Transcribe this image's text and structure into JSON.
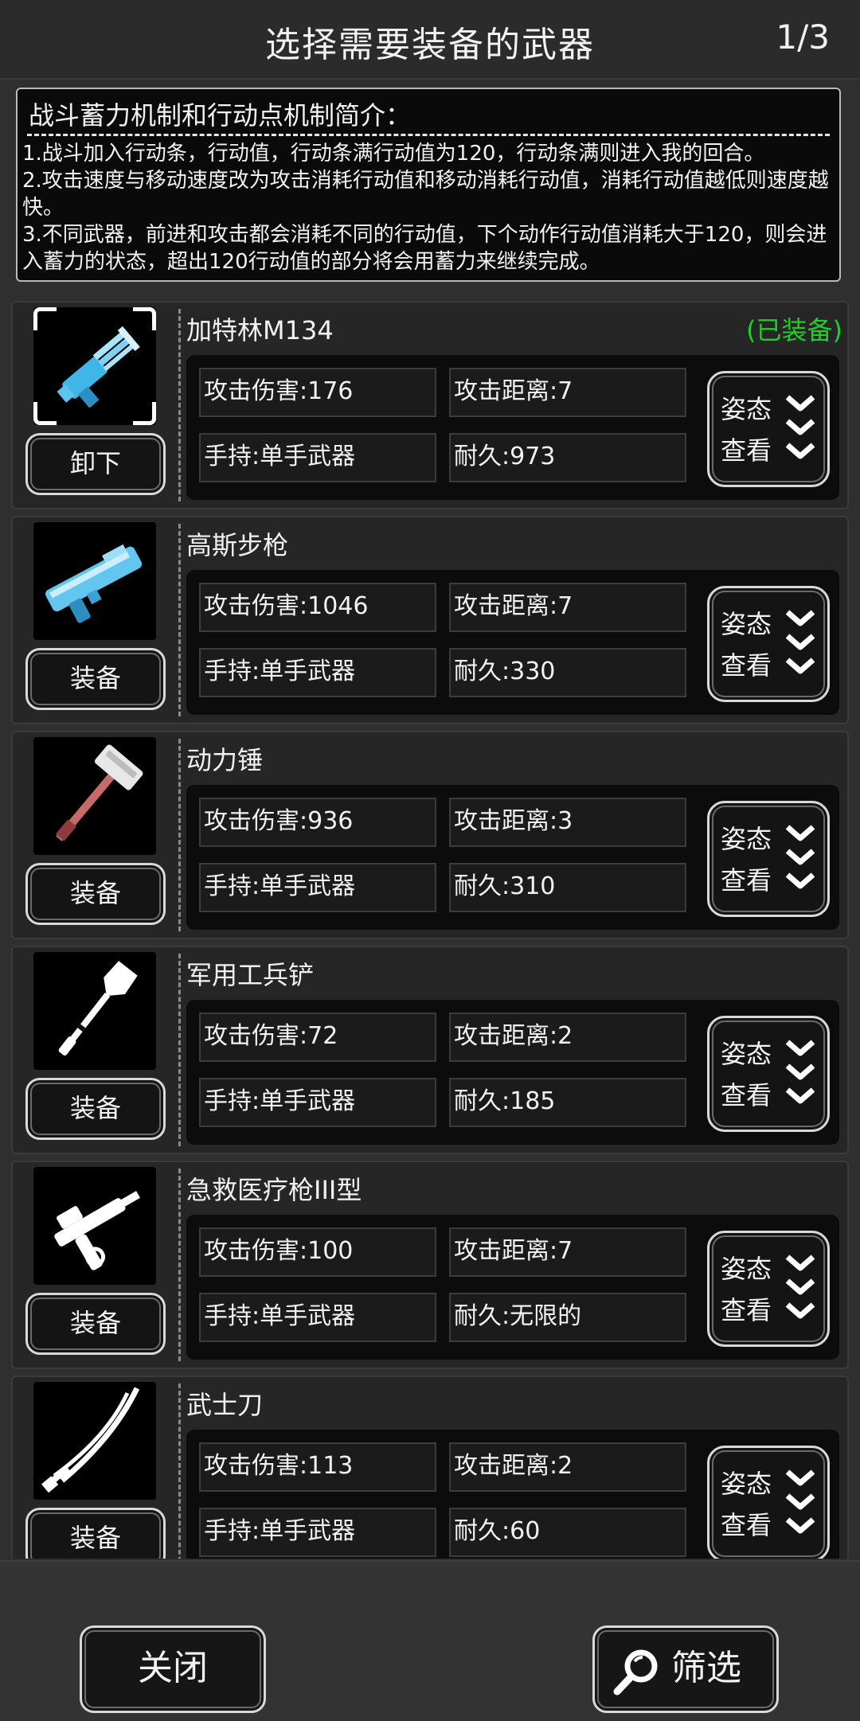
{
  "header": {
    "title": "选择需要装备的武器",
    "page": "1/3"
  },
  "intro": {
    "title": "战斗蓄力机制和行动点机制简介：",
    "lines": [
      "1.战斗加入行动条，行动值，行动条满行动值为120，行动条满则进入我的回合。",
      "2.攻击速度与移动速度改为攻击消耗行动值和移动消耗行动值，消耗行动值越低则速度越快。",
      "3.不同武器，前进和攻击都会消耗不同的行动值，下个动作行动值消耗大于120，则会进入蓄力的状态，超出120行动值的部分将会用蓄力来继续完成。"
    ]
  },
  "weapons": [
    {
      "name": "加特林M134",
      "status": "(已装备)",
      "action": "卸下",
      "attack": "攻击伤害:176",
      "range": "攻击距离:7",
      "hold": "手持:单手武器",
      "durability": "耐久:973",
      "pose1": "姿态",
      "pose2": "查看",
      "icon": "gatling-gun-icon"
    },
    {
      "name": "高斯步枪",
      "status": "",
      "action": "装备",
      "attack": "攻击伤害:1046",
      "range": "攻击距离:7",
      "hold": "手持:单手武器",
      "durability": "耐久:330",
      "pose1": "姿态",
      "pose2": "查看",
      "icon": "gauss-rifle-icon"
    },
    {
      "name": "动力锤",
      "status": "",
      "action": "装备",
      "attack": "攻击伤害:936",
      "range": "攻击距离:3",
      "hold": "手持:单手武器",
      "durability": "耐久:310",
      "pose1": "姿态",
      "pose2": "查看",
      "icon": "power-hammer-icon"
    },
    {
      "name": "军用工兵铲",
      "status": "",
      "action": "装备",
      "attack": "攻击伤害:72",
      "range": "攻击距离:2",
      "hold": "手持:单手武器",
      "durability": "耐久:185",
      "pose1": "姿态",
      "pose2": "查看",
      "icon": "shovel-icon"
    },
    {
      "name": "急救医疗枪III型",
      "status": "",
      "action": "装备",
      "attack": "攻击伤害:100",
      "range": "攻击距离:7",
      "hold": "手持:单手武器",
      "durability": "耐久:无限的",
      "pose1": "姿态",
      "pose2": "查看",
      "icon": "medical-gun-icon"
    },
    {
      "name": "武士刀",
      "status": "",
      "action": "装备",
      "attack": "攻击伤害:113",
      "range": "攻击距离:2",
      "hold": "手持:单手武器",
      "durability": "耐久:60",
      "pose1": "姿态",
      "pose2": "查看",
      "icon": "katana-icon"
    }
  ],
  "footer": {
    "close_label": "关闭",
    "filter_label": "筛选"
  },
  "colors": {
    "equipped": "#22cc2a",
    "background": "#2f2f2f"
  }
}
